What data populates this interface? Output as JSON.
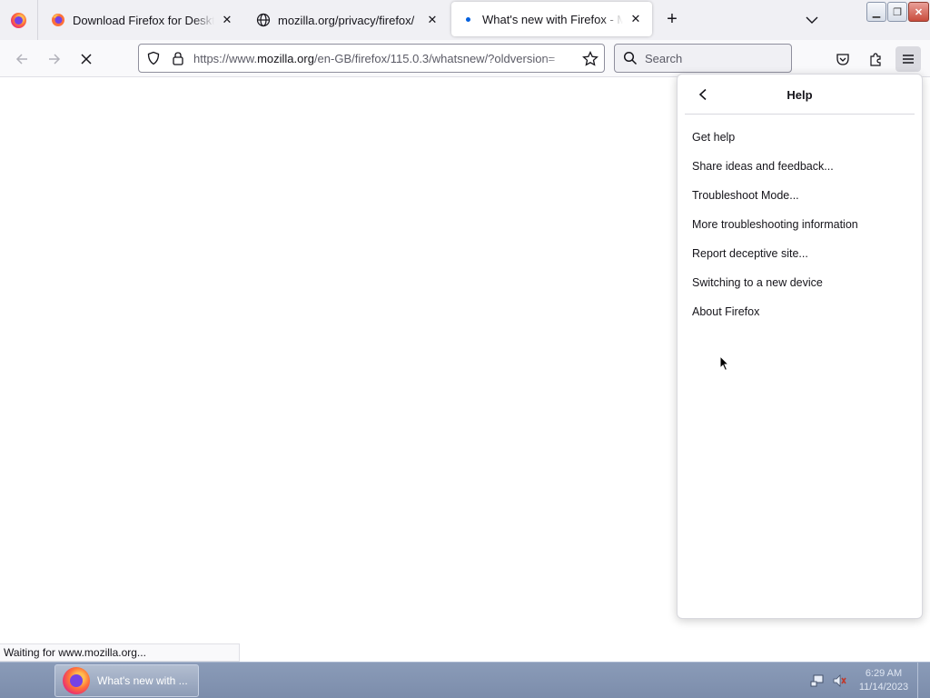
{
  "tabs": [
    {
      "title": "Download Firefox for Desktop — Fi",
      "icon": "firefox-icon"
    },
    {
      "title": "mozilla.org/privacy/firefox/",
      "icon": "globe-icon"
    },
    {
      "title": "What's new with Firefox - More",
      "icon": "loading-dot-icon",
      "active": true
    }
  ],
  "tab_close_glyph": "✕",
  "new_tab_glyph": "+",
  "window_controls": {
    "minimize": "▁",
    "maximize": "❐",
    "close": "✕"
  },
  "navbar": {
    "url_scheme": "https://www.",
    "url_host": "mozilla.org",
    "url_path": "/en-GB/firefox/115.0.3/whatsnew/?oldversion=",
    "search_placeholder": "Search"
  },
  "help_panel": {
    "title": "Help",
    "items": [
      "Get help",
      "Share ideas and feedback...",
      "Troubleshoot Mode...",
      "More troubleshooting information",
      "Report deceptive site...",
      "Switching to a new device",
      "About Firefox"
    ]
  },
  "status_text": "Waiting for www.mozilla.org...",
  "taskbar": {
    "task_label": "What's new with ...",
    "time": "6:29 AM",
    "date": "11/14/2023"
  },
  "colors": {
    "accent": "#0060df",
    "tabstrip": "#f0f0f4",
    "taskbar": "#8a9bb8"
  }
}
